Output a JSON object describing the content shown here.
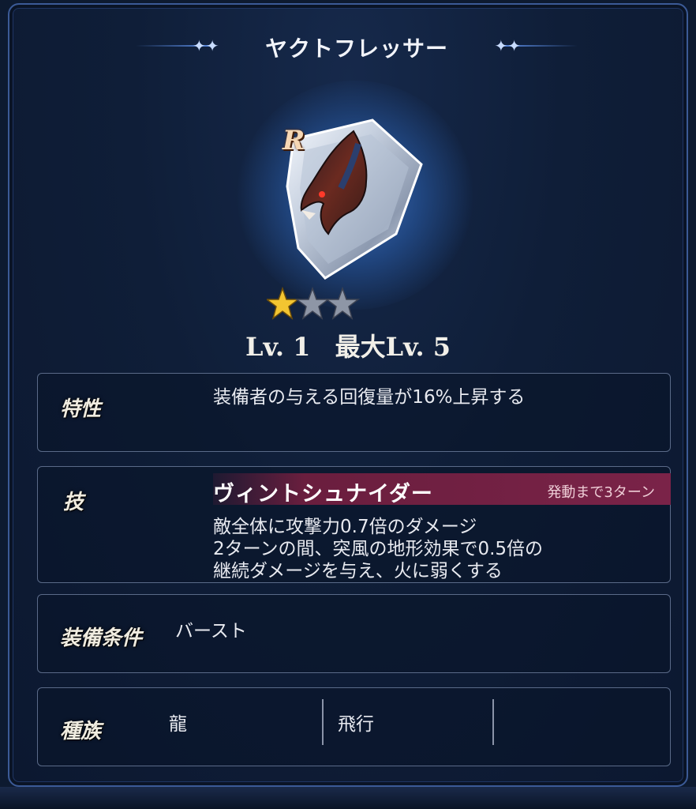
{
  "window": {
    "title": "ヤクトフレッサー"
  },
  "item": {
    "rarity": "R",
    "stars_filled": 1,
    "stars_total": 3,
    "level_label": "Lv. 1",
    "max_level_label": "最大Lv. 5"
  },
  "trait": {
    "label": "特性",
    "text": "装備者の与える回復量が16%上昇する"
  },
  "skill": {
    "label": "技",
    "name": "ヴィントシュナイダー",
    "timing": "発動まで3ターン",
    "lines": [
      "敵全体に攻撃力0.7倍のダメージ",
      "2ターンの間、突風の地形効果で0.5倍の",
      "継続ダメージを与え、火に弱くする"
    ]
  },
  "equip_condition": {
    "label": "装備条件",
    "value": "バースト"
  },
  "race": {
    "label": "種族",
    "values": [
      "龍",
      "飛行",
      ""
    ]
  },
  "colors": {
    "accent_blue": "#5b8de6",
    "skill_bar": "#7a2348",
    "star_gold": "#f3c531",
    "star_gray": "#8e96a6"
  },
  "icons": {
    "shield": "dragon-shield-icon",
    "star": "star-icon"
  }
}
